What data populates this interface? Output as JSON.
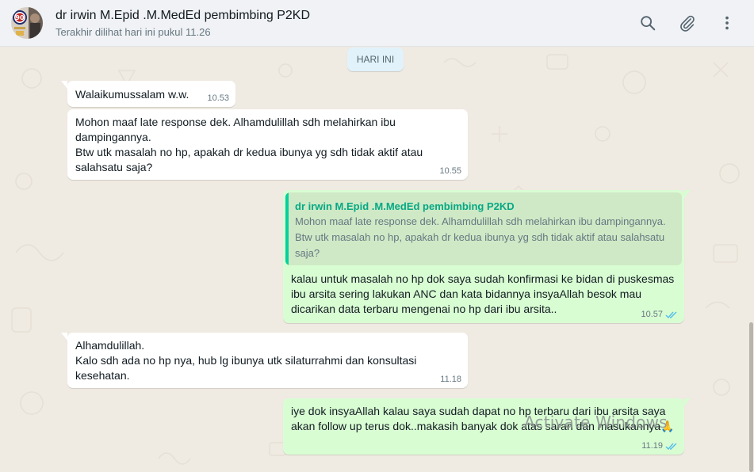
{
  "header": {
    "contact_name": "dr irwin M.Epid .M.MedEd pembimbing P2KD",
    "status": "Terakhir dilihat hari ini pukul 11.26",
    "avatar_badge": "90"
  },
  "icons": {
    "search": "search-icon",
    "attach": "paperclip-icon",
    "menu": "more-vertical-icon"
  },
  "chat": {
    "date_chip": "HARI INI",
    "messages": [
      {
        "direction": "incoming",
        "text": "Walaikumussalam w.w.",
        "time": "10.53"
      },
      {
        "direction": "incoming",
        "text": "Mohon maaf late response dek. Alhamdulillah sdh melahirkan ibu\ndampingannya.\nBtw utk masalah no hp, apakah dr kedua ibunya yg sdh tidak aktif atau\nsalahsatu saja?",
        "time": "10.55"
      },
      {
        "direction": "outgoing",
        "quoted_name": "dr irwin M.Epid .M.MedEd pembimbing P2KD",
        "quoted_text": "Mohon maaf late response dek. Alhamdulillah sdh melahirkan ibu dampingannya.\nBtw utk masalah no hp, apakah dr kedua ibunya yg sdh tidak aktif atau salahsatu\nsaja?",
        "text": "kalau untuk masalah no hp dok saya sudah konfirmasi ke bidan di puskesmas\nibu arsita sering lakukan ANC dan kata bidannya insyaAllah besok mau\ndicarikan data terbaru mengenai no hp dari ibu arsita..",
        "time": "10.57",
        "status": "read"
      },
      {
        "direction": "incoming",
        "text": "Alhamdulillah.\nKalo sdh ada no hp nya, hub lg ibunya utk silaturrahmi dan konsultasi\nkesehatan.",
        "time": "11.18"
      },
      {
        "direction": "outgoing",
        "text": "iye dok insyaAllah kalau saya sudah dapat no hp terbaru dari ibu arsita saya\nakan follow up terus dok..makasih banyak dok atas saran dan masukannya🙏",
        "time": "11.19",
        "status": "read"
      }
    ]
  },
  "watermark": "Activate Windows",
  "colors": {
    "incoming_bubble": "#ffffff",
    "outgoing_bubble": "#d9fdd3",
    "chat_background": "#efeae2",
    "read_ticks": "#53bdeb",
    "quote_accent": "#06cf9c"
  }
}
